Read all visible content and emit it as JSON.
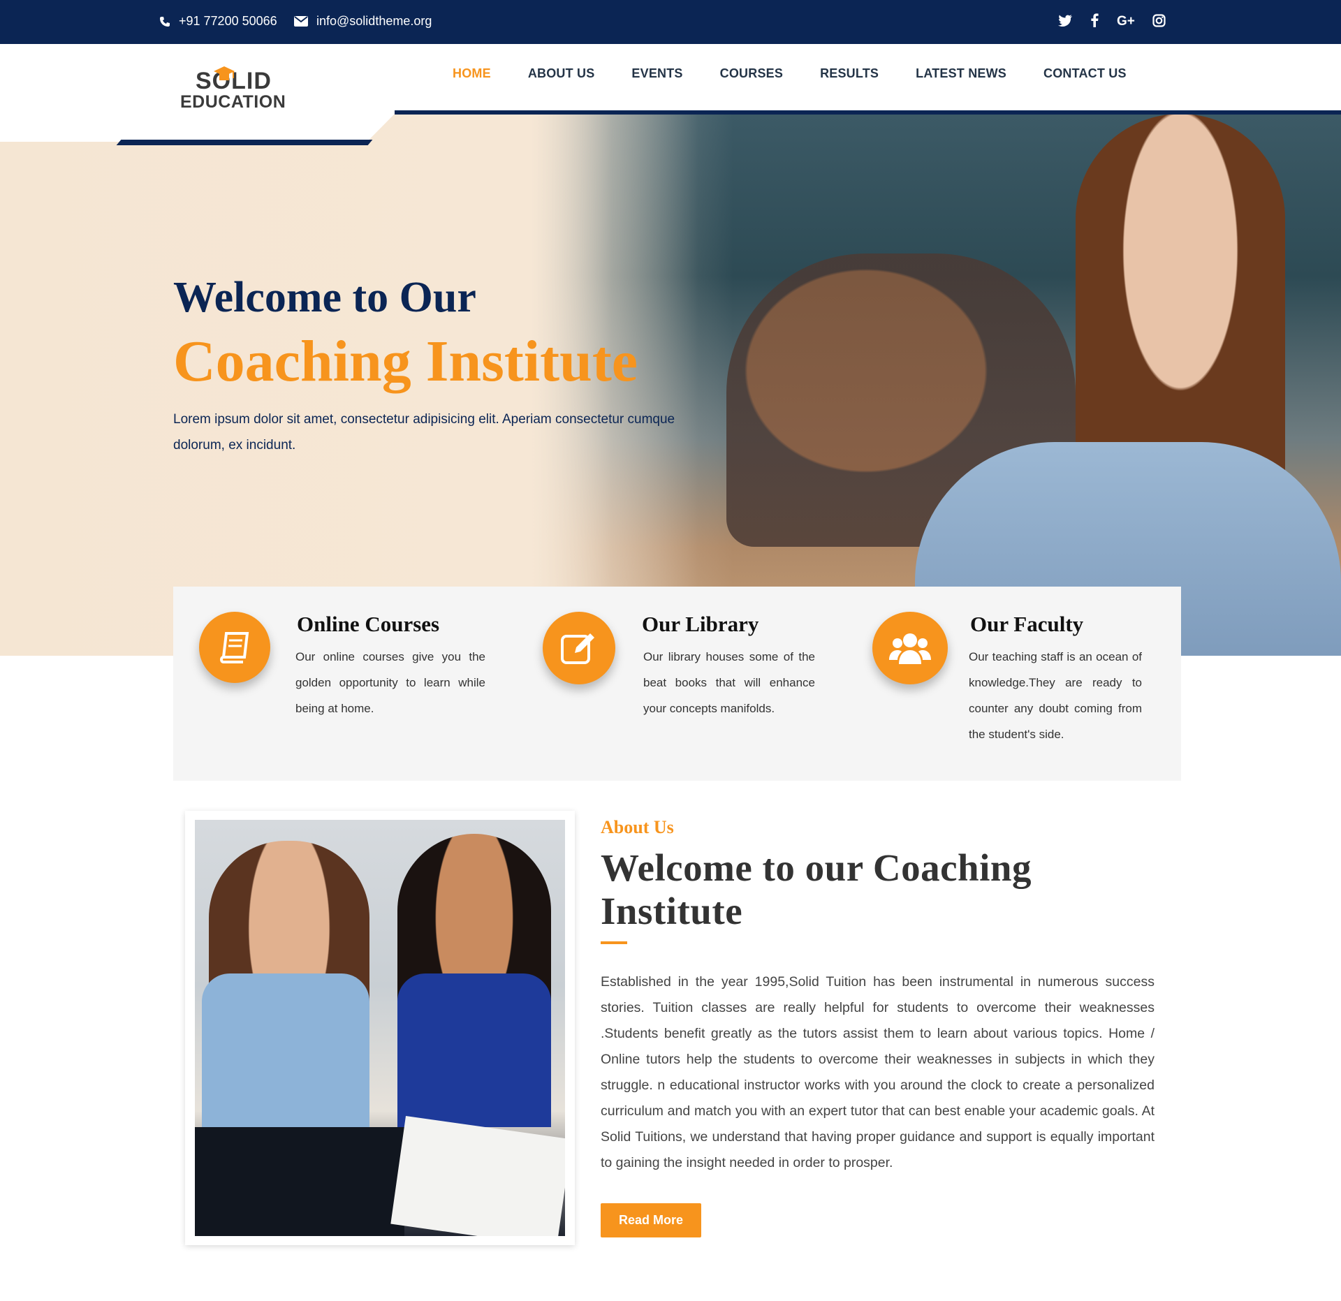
{
  "topbar": {
    "phone": "+91 77200 50066",
    "email": "info@solidtheme.org",
    "social": [
      "twitter-icon",
      "facebook-icon",
      "google-plus-icon",
      "instagram-icon"
    ]
  },
  "logo": {
    "line1": "SOLID",
    "line2": "EDUCATION"
  },
  "nav": {
    "items": [
      "HOME",
      "ABOUT US",
      "EVENTS",
      "COURSES",
      "RESULTS",
      "LATEST NEWS",
      "CONTACT US"
    ],
    "active": "HOME"
  },
  "hero": {
    "line1": "Welcome to Our",
    "line2": "Coaching Institute",
    "subtitle": "Lorem ipsum dolor sit amet, consectetur adipisicing elit. Aperiam consectetur cumque dolorum, ex incidunt."
  },
  "features": [
    {
      "icon": "book-icon",
      "title": "Online Courses",
      "desc": "Our online courses give you the golden opportunity to learn while being at home."
    },
    {
      "icon": "edit-icon",
      "title": "Our Library",
      "desc": "Our library houses some of the beat books that will enhance your concepts manifolds."
    },
    {
      "icon": "users-icon",
      "title": "Our Faculty",
      "desc": "Our teaching staff is an ocean of knowledge.They are ready to counter any doubt coming from the student's side."
    }
  ],
  "about": {
    "kicker": "About Us",
    "title": "Welcome to our Coaching Institute",
    "body": "Established in the year 1995,Solid Tuition has been instrumental in numerous success stories. Tuition classes are really helpful for students to overcome their weaknesses .Students benefit greatly as the tutors assist them to learn about various topics. Home / Online tutors help the students to overcome their weaknesses in subjects in which they struggle. n educational instructor works with you around the clock to create a personalized curriculum and match you with an expert tutor that can best enable your academic goals. At Solid Tuitions, we understand that having proper guidance and support is equally important to gaining the insight needed in order to prosper.",
    "button": "Read More"
  },
  "colors": {
    "navy": "#0b2554",
    "orange": "#f7941d",
    "feature_bg": "#f5f5f5"
  }
}
